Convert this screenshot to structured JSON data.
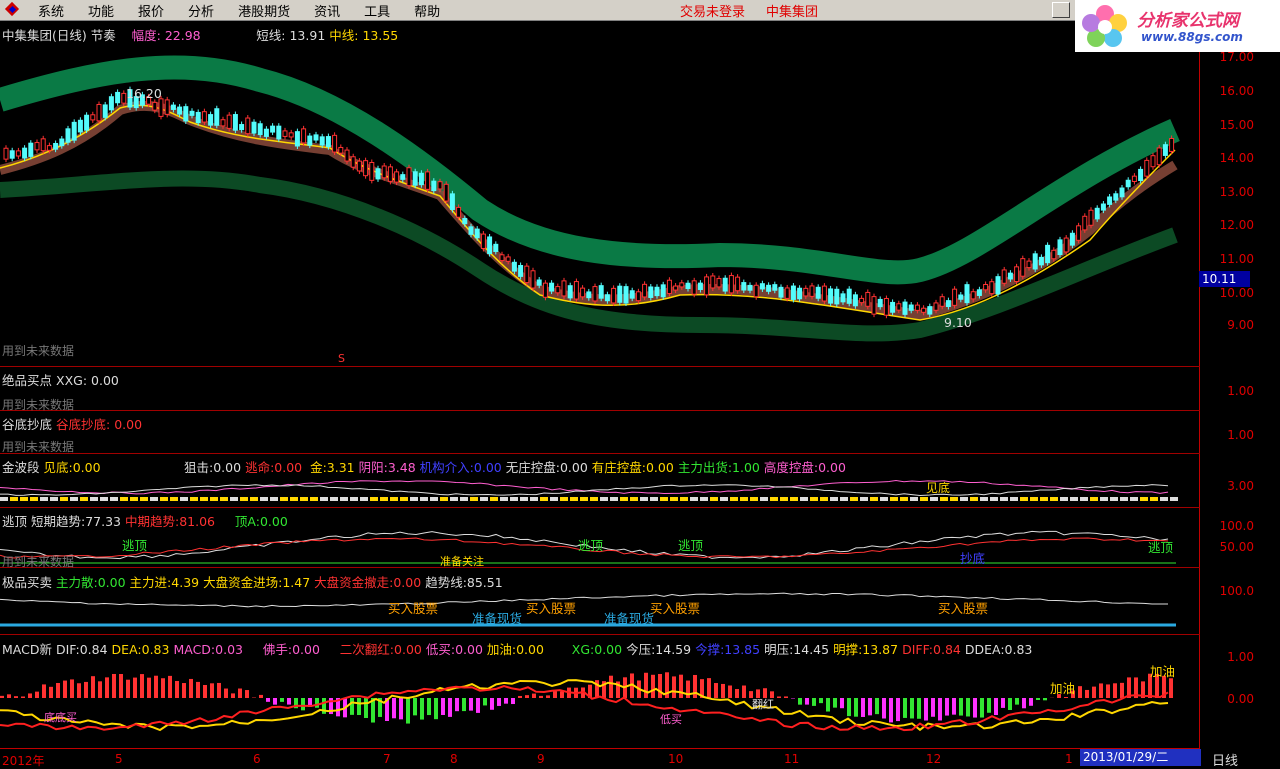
{
  "menu": [
    "系统",
    "功能",
    "报价",
    "分析",
    "港股期货",
    "资讯",
    "工具",
    "帮助"
  ],
  "status": {
    "login": "交易未登录",
    "stock": "中集集团"
  },
  "brand": {
    "name": "分析家公式网",
    "url": "www.88gs.com"
  },
  "main": {
    "title": "中集集团(日线) 节奏",
    "amplitude_label": "幅度:",
    "amplitude_value": "22.98",
    "short_label": "短线:",
    "short_value": "13.91",
    "mid_label": "中线:",
    "mid_value": "13.55",
    "high_note": "16.20",
    "low_note": "9.10",
    "future_note": "用到未来数据",
    "s_marker": "S",
    "yticks": [
      "17.00",
      "16.00",
      "15.00",
      "14.00",
      "13.00",
      "12.00",
      "11.00",
      "10.00",
      "9.00"
    ],
    "current_price": "10.11"
  },
  "panels": [
    {
      "id": "jpmd",
      "title": "绝品买点",
      "items": [
        [
          "XXG:",
          "0.00"
        ]
      ],
      "ytick": "1.00",
      "note": "用到未来数据"
    },
    {
      "id": "gdcd",
      "title": "谷底抄底",
      "items": [
        [
          "谷底抄底:",
          "0.00"
        ]
      ],
      "ytick": "1.00",
      "note": "用到未来数据"
    },
    {
      "id": "jbd",
      "title": "金波段",
      "items": [
        [
          "见底:",
          "0.00"
        ],
        [
          "狙击:",
          "0.00"
        ],
        [
          "逃命:",
          "0.00"
        ],
        [
          "金:",
          "3.31"
        ],
        [
          "阴阳:",
          "3.48"
        ],
        [
          "机构介入:",
          "0.00"
        ],
        [
          "无庄控盘:",
          "0.00"
        ],
        [
          "有庄控盘:",
          "0.00"
        ],
        [
          "主力出货:",
          "1.00"
        ],
        [
          "高度控盘:",
          "0.00"
        ]
      ],
      "ytick": "3.00",
      "note": ""
    },
    {
      "id": "td",
      "title": "逃顶",
      "items": [
        [
          "短期趋势:",
          "77.33"
        ],
        [
          "中期趋势:",
          "81.06"
        ],
        [
          "顶A:",
          "0.00"
        ]
      ],
      "yticks": [
        "100.0",
        "50.00"
      ],
      "note": "用到未来数据"
    },
    {
      "id": "jpmm",
      "title": "极品买卖",
      "items": [
        [
          "主力散:",
          "0.00"
        ],
        [
          "主力进:",
          "4.39"
        ],
        [
          "大盘资金进场:",
          "1.47"
        ],
        [
          "大盘资金撤走:",
          "0.00"
        ],
        [
          "趋势线:",
          "85.51"
        ]
      ],
      "ytick": "100.0",
      "note": ""
    },
    {
      "id": "macd",
      "title": "MACD新",
      "items": [
        [
          "DIF:",
          "0.84"
        ],
        [
          "DEA:",
          "0.83"
        ],
        [
          "MACD:",
          "0.03"
        ],
        [
          "佛手:",
          "0.00"
        ],
        [
          "二次翻红:",
          "0.00"
        ],
        [
          "低买:",
          "0.00"
        ],
        [
          "加油:",
          "0.00"
        ],
        [
          "XG:",
          "0.00"
        ],
        [
          "今压:",
          "14.59"
        ],
        [
          "今撑:",
          "13.85"
        ],
        [
          "明压:",
          "14.45"
        ],
        [
          "明撑:",
          "13.87"
        ],
        [
          "DIFF:",
          "0.84"
        ],
        [
          "DDEA:",
          "0.83"
        ]
      ],
      "yticks": [
        "1.00",
        "0.00"
      ],
      "note": ""
    }
  ],
  "annotations": {
    "escape_top": "逃顶",
    "bottom": "见底",
    "prepare_buy": "准备现货",
    "buy_stock": "买入股票",
    "cheap_buy": "低买",
    "bottom_buy": "底底买",
    "add_oil": "加油",
    "flip_red": "翻红",
    "copy_bottom": "抄底",
    "watch": "准备关注"
  },
  "xaxis": {
    "labels": [
      "2012年",
      "5",
      "6",
      "7",
      "8",
      "9",
      "10",
      "11",
      "12",
      "1"
    ],
    "date": "2013/01/29/二",
    "period": "日线"
  },
  "colors": {
    "up": "#ff3232",
    "down": "#54fcfc",
    "band": "#0a6b3a",
    "grid": "#a00000",
    "axis_text": "#e00000"
  }
}
